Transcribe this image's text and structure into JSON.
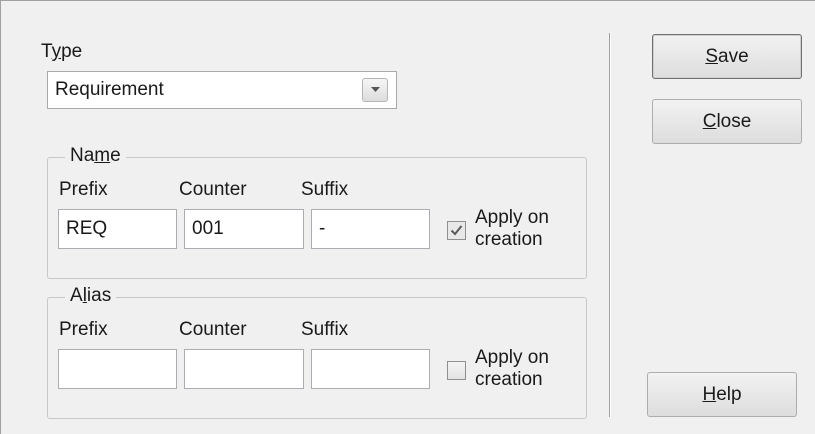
{
  "type_section": {
    "label": "Type",
    "label_mnemonic": "y",
    "combo_value": "Requirement"
  },
  "name_group": {
    "title": "Name",
    "title_mnemonic": "m",
    "prefix_label": "Prefix",
    "counter_label": "Counter",
    "suffix_label": "Suffix",
    "prefix_value": "REQ",
    "counter_value": "001",
    "suffix_value": "-",
    "apply_line1": "Apply on",
    "apply_line2": "creation",
    "apply_checked": true
  },
  "alias_group": {
    "title": "Alias",
    "title_mnemonic": "l",
    "prefix_label": "Prefix",
    "counter_label": "Counter",
    "suffix_label": "Suffix",
    "prefix_value": "",
    "counter_value": "",
    "suffix_value": "",
    "apply_line1": "Apply on",
    "apply_line2": "creation",
    "apply_checked": false
  },
  "buttons": {
    "save": "Save",
    "save_mnemonic": "S",
    "close": "Close",
    "close_mnemonic": "C",
    "help": "Help",
    "help_mnemonic": "H"
  },
  "icons": {
    "combo_arrow": "chevron-down-icon",
    "checkmark": "checkmark-icon"
  }
}
